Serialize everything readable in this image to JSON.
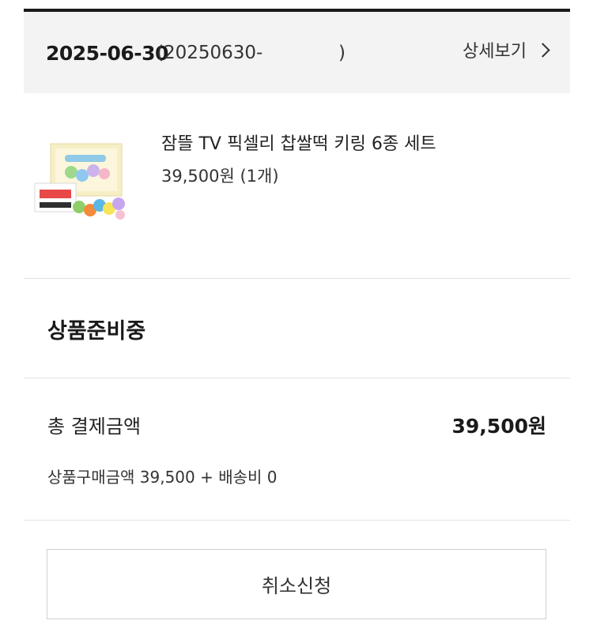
{
  "order": {
    "date": "2025-06-30",
    "number_open": "(20250630-",
    "number_close": ")",
    "detail_label": "상세보기"
  },
  "product": {
    "name": "잠뜰 TV 픽셀리 찹쌀떡 키링 6종 세트",
    "price": "39,500원 (1개)"
  },
  "status": {
    "label": "상품준비중"
  },
  "payment": {
    "total_label": "총 결제금액",
    "total_value": "39,500원",
    "breakdown": "상품구매금액 39,500 + 배송비 0"
  },
  "actions": {
    "cancel_label": "취소신청"
  },
  "colors": {
    "header_bg": "#f3f3f3",
    "top_border": "#1a1a1a",
    "divider": "#e2e2e2"
  },
  "icons": {
    "detail": "chevron-right-icon"
  }
}
